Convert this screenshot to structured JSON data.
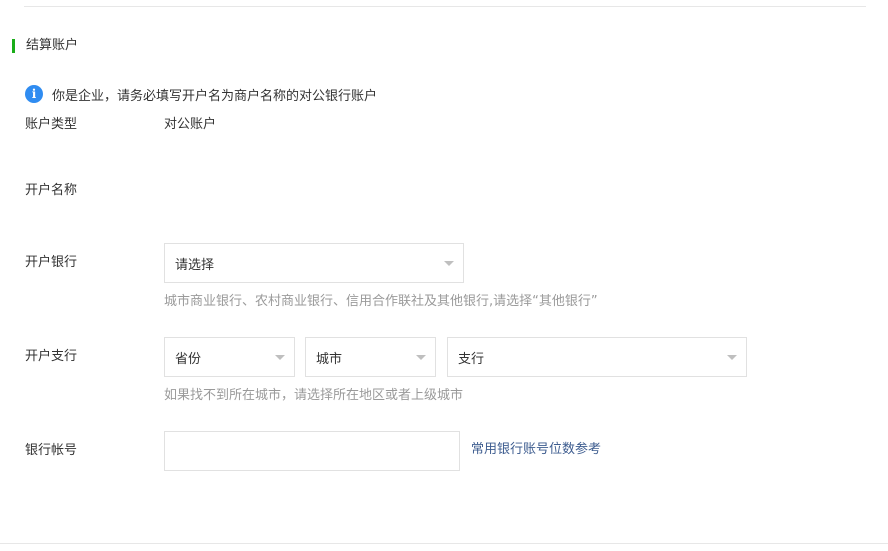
{
  "section": {
    "title": "结算账户",
    "accent_color": "#1aad19"
  },
  "notice": {
    "icon": "info-icon",
    "icon_glyph": "i",
    "text": "你是企业，请务必填写开户名为商户名称的对公银行账户"
  },
  "fields": {
    "account_type": {
      "label": "账户类型",
      "value": "对公账户"
    },
    "account_name": {
      "label": "开户名称"
    },
    "bank": {
      "label": "开户银行",
      "selected": "请选择",
      "hint": "城市商业银行、农村商业银行、信用合作联社及其他银行,请选择“其他银行”"
    },
    "branch": {
      "label": "开户支行",
      "province": "省份",
      "city": "城市",
      "branch": "支行",
      "hint": "如果找不到所在城市，请选择所在地区或者上级城市"
    },
    "account_number": {
      "label": "银行帐号",
      "value": "",
      "reference_link": "常用银行账号位数参考"
    }
  }
}
